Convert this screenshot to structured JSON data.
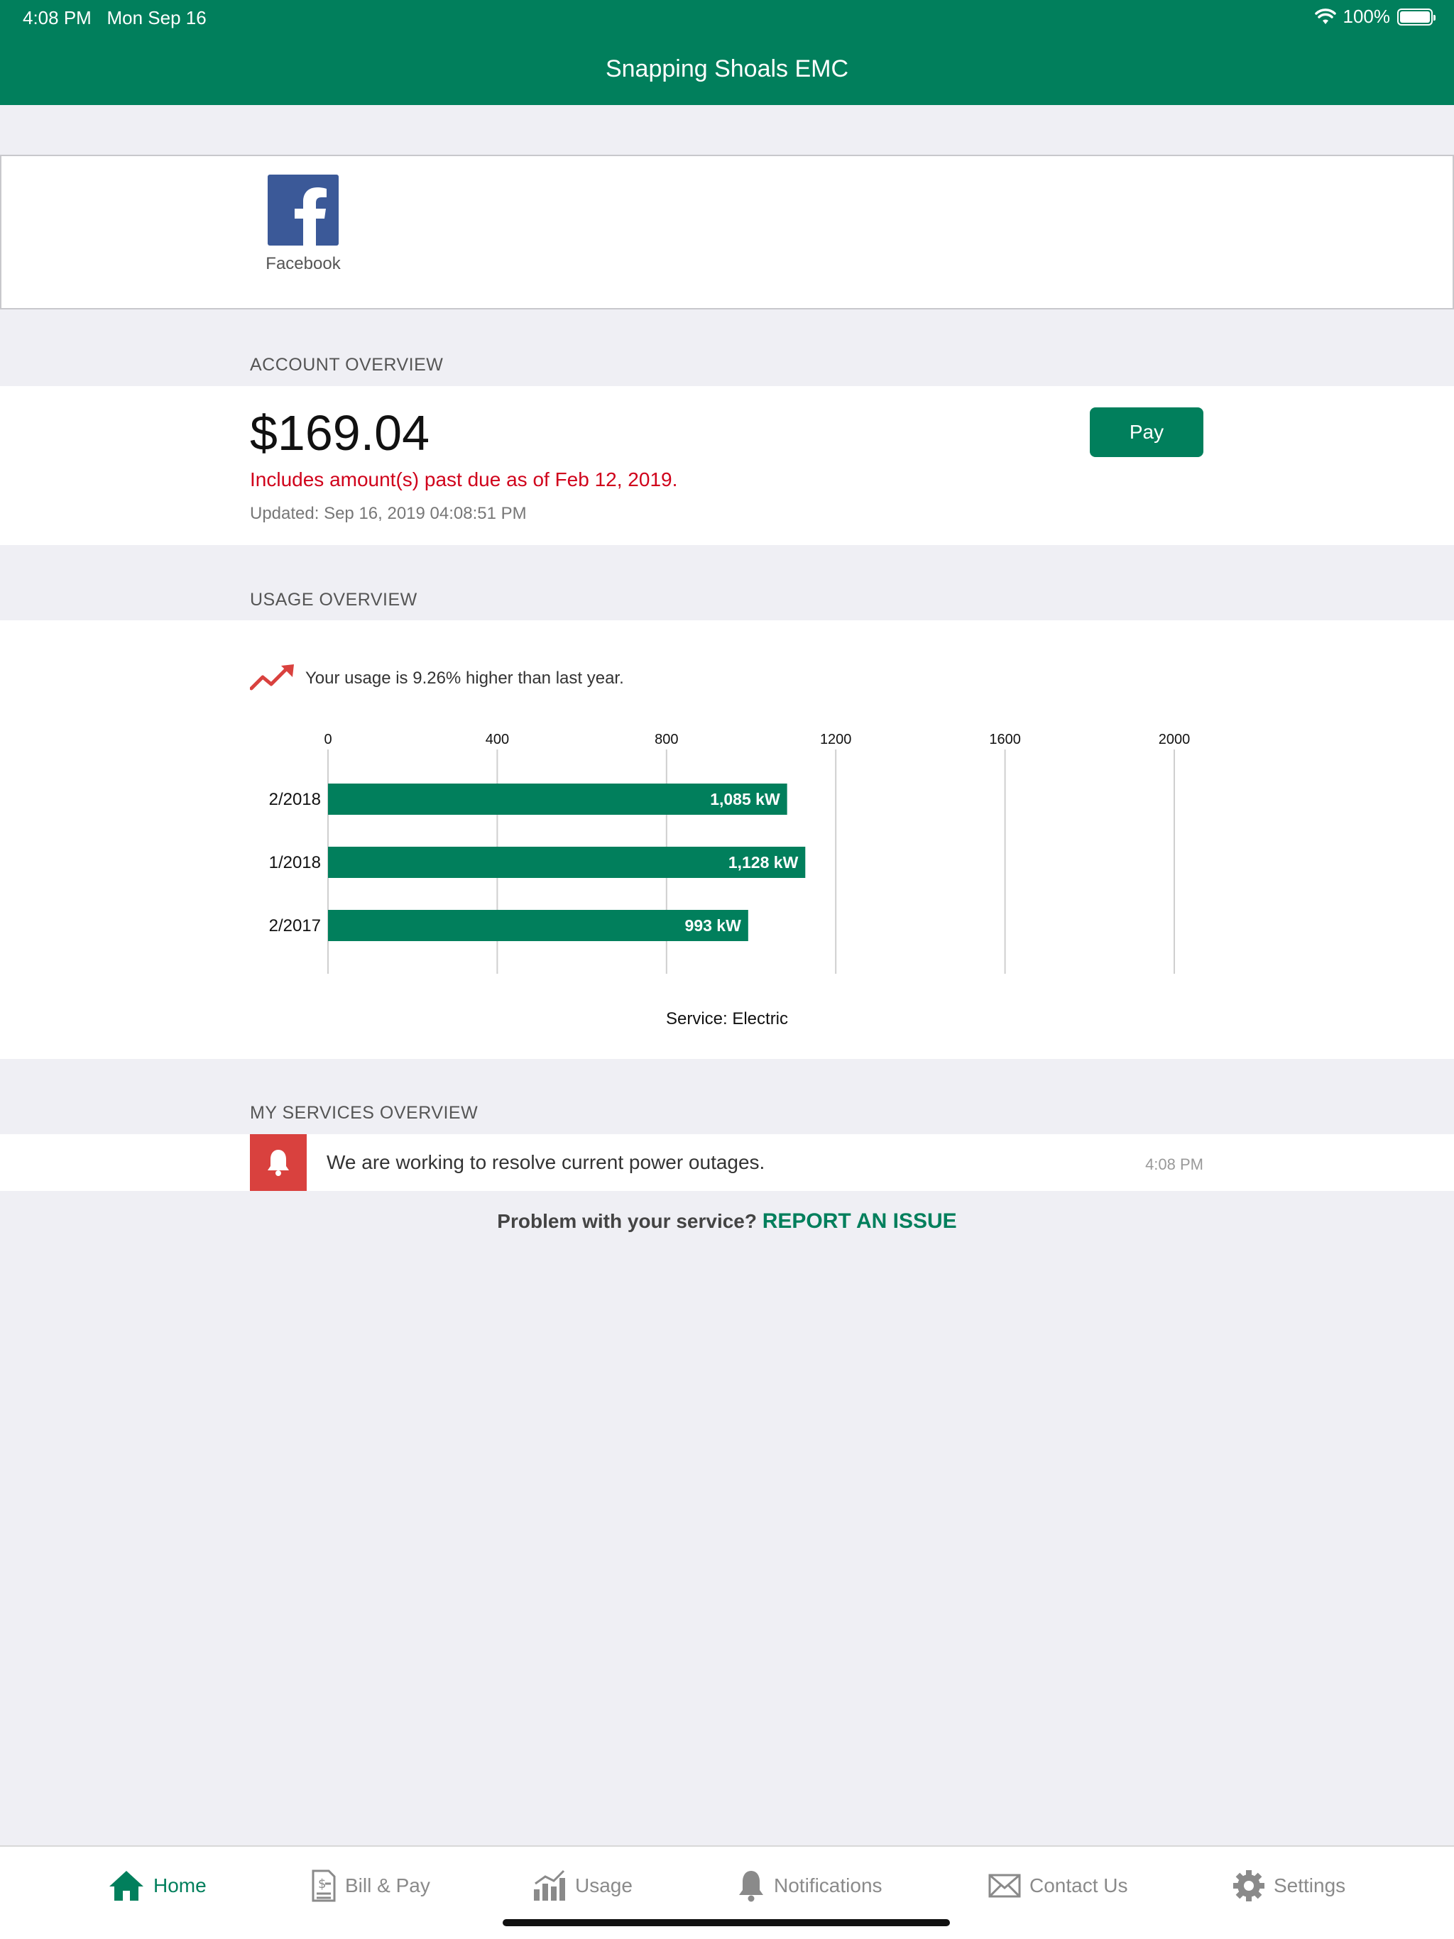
{
  "status_bar": {
    "time": "4:08 PM",
    "date": "Mon Sep 16",
    "battery": "100%"
  },
  "app": {
    "title": "Snapping Shoals EMC"
  },
  "social": {
    "facebook_label": "Facebook"
  },
  "account": {
    "section_title": "ACCOUNT OVERVIEW",
    "amount": "$169.04",
    "past_due": "Includes amount(s) past due as of Feb 12, 2019.",
    "updated": "Updated: Sep 16, 2019 04:08:51 PM",
    "pay_label": "Pay"
  },
  "usage": {
    "section_title": "USAGE OVERVIEW",
    "trend_text": "Your usage is 9.26% higher than last year.",
    "service_label": "Service: Electric"
  },
  "chart_data": {
    "type": "bar",
    "orientation": "horizontal",
    "categories": [
      "2/2018",
      "1/2018",
      "2/2017"
    ],
    "values": [
      1085,
      1128,
      993
    ],
    "value_labels": [
      "1,085 kW",
      "1,128 kW",
      "993 kW"
    ],
    "ticks": [
      "0",
      "400",
      "800",
      "1200",
      "1600",
      "2000"
    ],
    "xlim": [
      0,
      2000
    ],
    "grid": true,
    "color": "#017f5c"
  },
  "services": {
    "section_title": "MY SERVICES OVERVIEW",
    "alert_text": "We are working to resolve current power outages.",
    "alert_time": "4:08 PM",
    "report_prefix": "Problem with your service?",
    "report_link": "REPORT AN ISSUE"
  },
  "tabs": [
    {
      "label": "Home",
      "icon": "home-icon"
    },
    {
      "label": "Bill & Pay",
      "icon": "bill-icon"
    },
    {
      "label": "Usage",
      "icon": "usage-chart-icon"
    },
    {
      "label": "Notifications",
      "icon": "bell-icon"
    },
    {
      "label": "Contact Us",
      "icon": "envelope-icon"
    },
    {
      "label": "Settings",
      "icon": "gear-icon"
    }
  ],
  "colors": {
    "brand": "#017f5c",
    "alert": "#d9413e",
    "past_due": "#d0021b"
  }
}
